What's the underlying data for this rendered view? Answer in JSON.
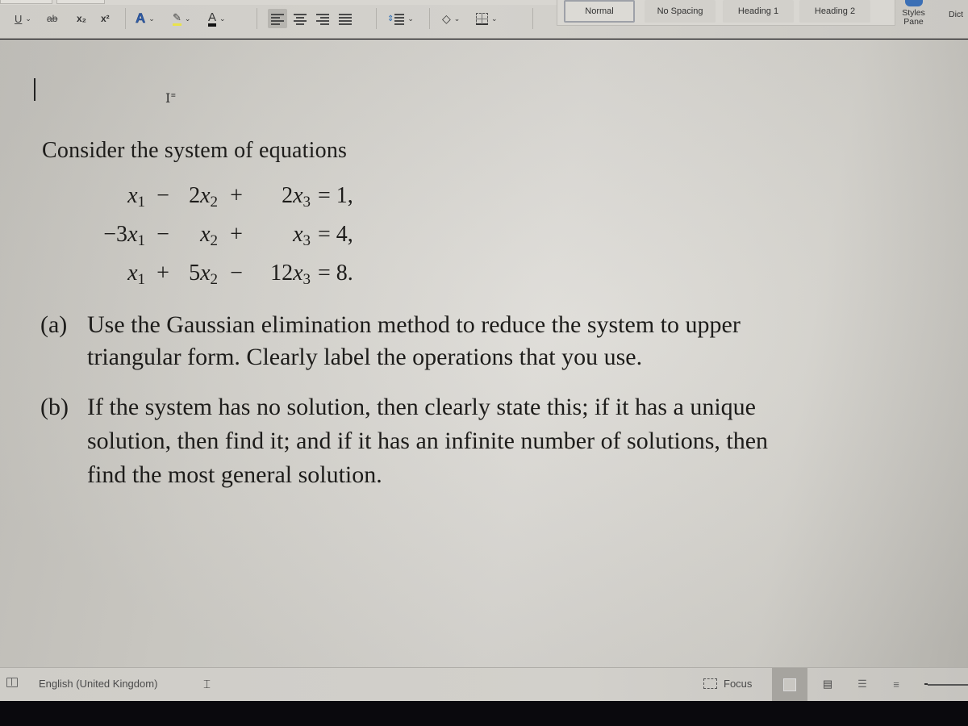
{
  "ribbon": {
    "font_tools": [
      {
        "id": "underline",
        "label": "U"
      },
      {
        "id": "strikethrough",
        "label": "ab"
      },
      {
        "id": "subscript",
        "label": "x₂"
      },
      {
        "id": "superscript",
        "label": "x²"
      },
      {
        "id": "text-effects",
        "label": "A"
      },
      {
        "id": "highlight",
        "label": "✎"
      },
      {
        "id": "font-color",
        "label": "A"
      }
    ],
    "colors": {
      "text_effects": "#2f5da8",
      "highlight": "#e9e24a",
      "font_color": "#111111"
    },
    "styles": [
      "Normal",
      "No Spacing",
      "Heading 1",
      "Heading 2"
    ],
    "selected_style": "Normal",
    "styles_pane_label_1": "Styles",
    "styles_pane_label_2": "Pane",
    "dictate_label": "Dict"
  },
  "document": {
    "intro": "Consider the system of equations",
    "equations": [
      {
        "c1": "",
        "v1": "x",
        "s1": "1",
        "op1": "−",
        "c2": "2",
        "v2": "x",
        "s2": "2",
        "op2": "+",
        "c3": "2",
        "v3": "x",
        "s3": "3",
        "rhs": "= 1,"
      },
      {
        "c1": "−3",
        "v1": "x",
        "s1": "1",
        "op1": "−",
        "c2": "",
        "v2": "x",
        "s2": "2",
        "op2": "+",
        "c3": "",
        "v3": "x",
        "s3": "3",
        "rhs": "= 4,"
      },
      {
        "c1": "",
        "v1": "x",
        "s1": "1",
        "op1": "+",
        "c2": "5",
        "v2": "x",
        "s2": "2",
        "op2": "−",
        "c3": "12",
        "v3": "x",
        "s3": "3",
        "rhs": "= 8."
      }
    ],
    "parts": [
      {
        "label": "(a)",
        "lines": [
          "Use the Gaussian elimination method to reduce the system to upper",
          "triangular form. Clearly label the operations that you use."
        ]
      },
      {
        "label": "(b)",
        "lines": [
          "If the system has no solution, then clearly state this; if it has a unique",
          "solution, then find it; and if it has an infinite number of solutions, then",
          "find the most general solution."
        ]
      }
    ]
  },
  "statusbar": {
    "language": "English (United Kingdom)",
    "focus_label": "Focus"
  }
}
